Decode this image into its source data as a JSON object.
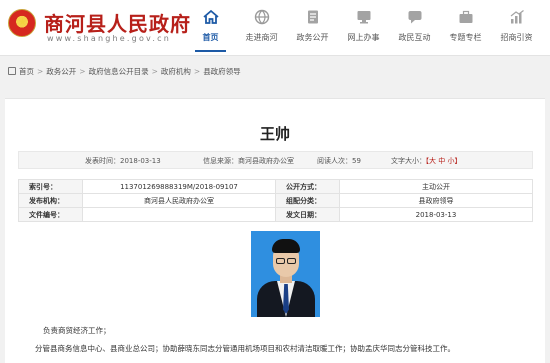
{
  "site": {
    "title": "商河县人民政府",
    "url": "www.shanghe.gov.cn"
  },
  "nav": [
    {
      "label": "首页",
      "icon": "home-icon",
      "active": true
    },
    {
      "label": "走进商河",
      "icon": "globe-icon"
    },
    {
      "label": "政务公开",
      "icon": "document-icon"
    },
    {
      "label": "网上办事",
      "icon": "monitor-icon"
    },
    {
      "label": "政民互动",
      "icon": "chat-icon"
    },
    {
      "label": "专题专栏",
      "icon": "briefcase-icon"
    },
    {
      "label": "招商引资",
      "icon": "chart-icon"
    }
  ],
  "breadcrumb": [
    "首页",
    "政务公开",
    "政府信息公开目录",
    "政府机构",
    "县政府领导"
  ],
  "article": {
    "title": "王帅",
    "meta": {
      "publish_time": "发表时间：2018-03-13",
      "source": "信息来源：商河县政府办公室",
      "views": "阅读人次：59",
      "font_size_label": "文字大小：",
      "font_size_options": "【大 中 小】"
    },
    "info_table": {
      "index_label": "索引号：",
      "index_value": "113701269888319M/2018-09107",
      "public_method_label": "公开方式：",
      "public_method_value": "主动公开",
      "issuer_label": "发布机构：",
      "issuer_value": "商河县人民政府办公室",
      "category_label": "组配分类：",
      "category_value": "县政府领导",
      "doc_no_label": "文件编号：",
      "doc_no_value": "",
      "date_label": "发文日期：",
      "date_value": "2018-03-13"
    },
    "paragraphs": [
      "负责商贸经济工作；",
      "分管县商务信息中心、县商业总公司；协助薛晓东同志分管通用机场项目和农村清洁取暖工作；协助孟庆华同志分管科技工作。"
    ]
  },
  "colors": {
    "brand_red": "#b7201a",
    "nav_active": "#1d5aa6",
    "photo_bg": "#2f8fe0"
  }
}
